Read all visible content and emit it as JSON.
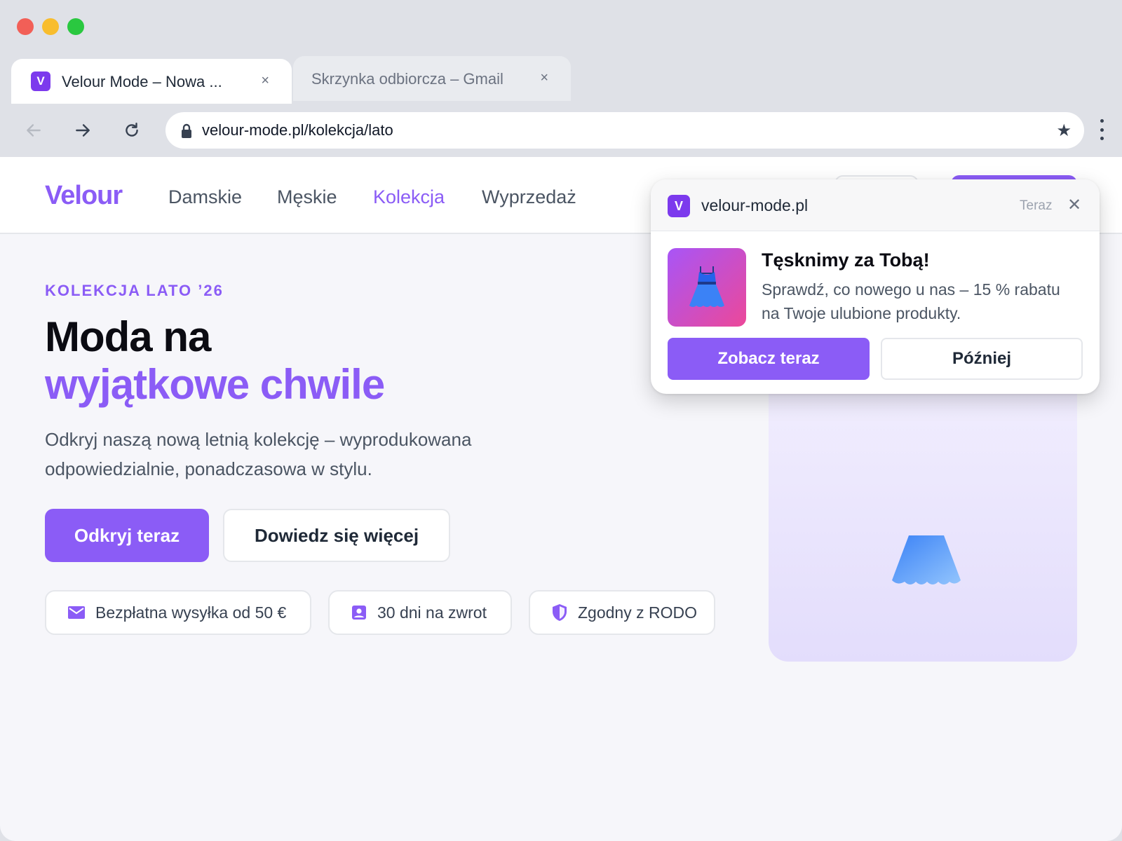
{
  "browser": {
    "tabs": [
      {
        "favicon": "V",
        "title": "Velour Mode – Nowa ...",
        "close": "×",
        "active": true
      },
      {
        "title": "Skrzynka odbiorcza – Gmail",
        "close": "×",
        "active": false
      }
    ],
    "url": "velour-mode.pl/kolekcja/lato",
    "icons": {
      "back": "arrow-left-icon",
      "forward": "arrow-right-icon",
      "reload": "reload-icon",
      "lock": "lock-icon",
      "bookmark": "star-icon",
      "menu": "more-vertical-icon"
    }
  },
  "site": {
    "logo": "Velour",
    "nav": [
      "Damskie",
      "Męskie",
      "Kolekcja",
      "Wyprzedaż"
    ],
    "active_nav": "Kolekcja",
    "accent": "#8b5cf6"
  },
  "hero": {
    "eyebrow": "KOLEKCJA LATO ’26",
    "headline_line1": "Moda na",
    "headline_line2": "wyjątkowe chwile",
    "lead": "Odkryj naszą nową letnią kolekcję – wyprodukowana odpowiedzialnie, ponadczasowa w stylu.",
    "primary_cta": "Odkryj teraz",
    "secondary_cta": "Dowiedz się więcej",
    "features": [
      {
        "icon": "mail-icon",
        "label": "Bezpłatna wysyłka od 50 €"
      },
      {
        "icon": "user-badge-icon",
        "label": "30 dni na zwrot"
      },
      {
        "icon": "shield-icon",
        "label": "Zgodny z RODO"
      }
    ]
  },
  "notification": {
    "favicon": "V",
    "site": "velour-mode.pl",
    "time": "Teraz",
    "close": "✕",
    "thumb_icon": "dress-icon",
    "title": "Tęsknimy za Tobą!",
    "body": "Sprawdź, co nowego u nas – 15 % rabatu na Twoje ulubione produkty.",
    "primary": "Zobacz teraz",
    "secondary": "Później"
  }
}
